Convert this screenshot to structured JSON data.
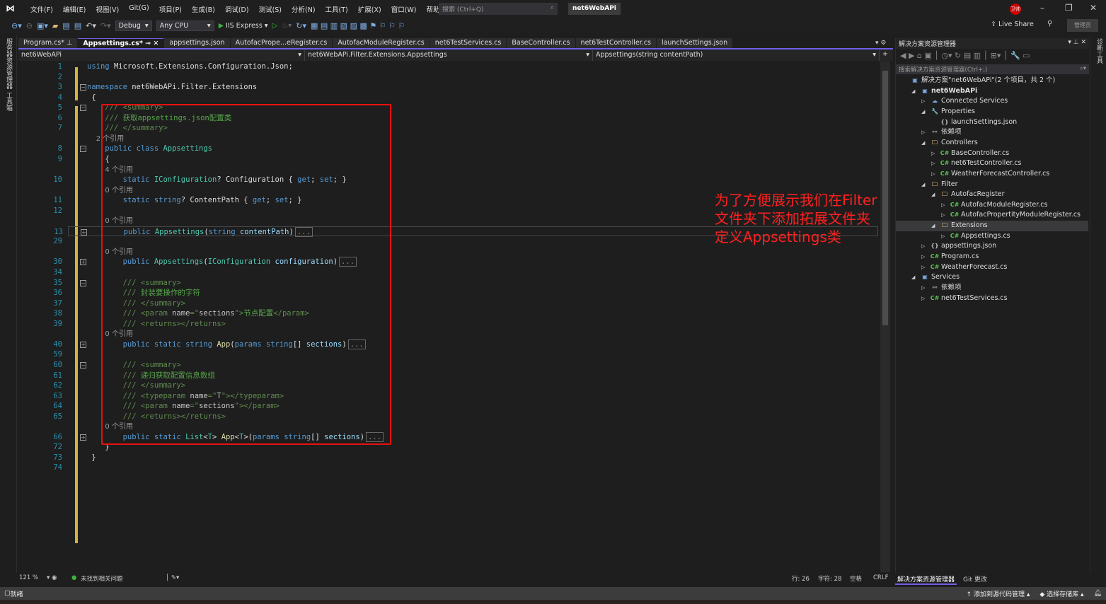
{
  "titlebar": {
    "menu": [
      "文件(F)",
      "编辑(E)",
      "视图(V)",
      "Git(G)",
      "项目(P)",
      "生成(B)",
      "调试(D)",
      "测试(S)",
      "分析(N)",
      "工具(T)",
      "扩展(X)",
      "窗口(W)",
      "帮助(H)"
    ],
    "search_placeholder": "搜索 (Ctrl+Q)",
    "project": "net6WebAPi",
    "avatar": "卫帅"
  },
  "toolbar": {
    "config": "Debug",
    "platform": "Any CPU",
    "run": "IIS Express",
    "live_share": "Live Share",
    "admin": "管理员"
  },
  "left_strip": [
    "服务器资源管理器",
    "工具箱"
  ],
  "tabs": [
    {
      "label": "Program.cs*",
      "active": false
    },
    {
      "label": "Appsettings.cs*",
      "active": true
    },
    {
      "label": "appsettings.json",
      "active": false
    },
    {
      "label": "AutofacPrope...eRegister.cs",
      "active": false
    },
    {
      "label": "AutofacModuleRegister.cs",
      "active": false
    },
    {
      "label": "net6TestServices.cs",
      "active": false
    },
    {
      "label": "BaseController.cs",
      "active": false
    },
    {
      "label": "net6TestController.cs",
      "active": false
    },
    {
      "label": "launchSettings.json",
      "active": false
    }
  ],
  "navbar": {
    "project": "net6WebAPi",
    "type": "net6WebAPi.Filter.Extensions.Appsettings",
    "member": "Appsettings(string contentPath)"
  },
  "code": [
    {
      "ln": "1",
      "t": [
        [
          "kw",
          "using "
        ],
        [
          "pl",
          "Microsoft.Extensions.Configuration.Json;"
        ]
      ]
    },
    {
      "ln": "2",
      "t": []
    },
    {
      "ln": "3",
      "f": "-",
      "t": [
        [
          "kw",
          "namespace "
        ],
        [
          "pl",
          "net6WebAPi.Filter.Extensions"
        ]
      ]
    },
    {
      "ln": "4",
      "t": [
        [
          "pl",
          " {"
        ]
      ]
    },
    {
      "ln": "5",
      "f": "-",
      "t": [
        [
          "cg",
          "    /// <summary>"
        ]
      ]
    },
    {
      "ln": "6",
      "t": [
        [
          "cg",
          "    /// "
        ],
        [
          "cm",
          "获取appsettings.json配置类"
        ]
      ]
    },
    {
      "ln": "7",
      "t": [
        [
          "cg",
          "    /// </summary>"
        ]
      ]
    },
    {
      "ln": "",
      "t": [
        [
          "lens",
          "    2 个引用"
        ]
      ]
    },
    {
      "ln": "8",
      "f": "-",
      "t": [
        [
          "kw",
          "    public class "
        ],
        [
          "ty",
          "Appsettings"
        ]
      ]
    },
    {
      "ln": "9",
      "t": [
        [
          "pl",
          "    {"
        ]
      ]
    },
    {
      "ln": "",
      "t": [
        [
          "lens",
          "        4 个引用"
        ]
      ]
    },
    {
      "ln": "10",
      "t": [
        [
          "kw",
          "        static "
        ],
        [
          "ty",
          "IConfiguration"
        ],
        [
          "pl",
          "? Configuration { "
        ],
        [
          "kw",
          "get"
        ],
        [
          "pl",
          "; "
        ],
        [
          "kw",
          "set"
        ],
        [
          "pl",
          "; }"
        ]
      ]
    },
    {
      "ln": "",
      "t": [
        [
          "lens",
          "        0 个引用"
        ]
      ]
    },
    {
      "ln": "11",
      "t": [
        [
          "kw",
          "        static string"
        ],
        [
          "pl",
          "? ContentPath { "
        ],
        [
          "kw",
          "get"
        ],
        [
          "pl",
          "; "
        ],
        [
          "kw",
          "set"
        ],
        [
          "pl",
          "; }"
        ]
      ]
    },
    {
      "ln": "12",
      "t": []
    },
    {
      "ln": "",
      "t": [
        [
          "lens",
          "        0 个引用"
        ]
      ]
    },
    {
      "ln": "13",
      "f": "+",
      "t": [
        [
          "kw",
          "        public "
        ],
        [
          "ty",
          "Appsettings"
        ],
        [
          "pl",
          "("
        ],
        [
          "kw",
          "string "
        ],
        [
          "par",
          "contentPath"
        ],
        [
          "pl",
          ")"
        ],
        [
          "coll",
          "..."
        ]
      ]
    },
    {
      "ln": "29",
      "t": []
    },
    {
      "ln": "",
      "t": [
        [
          "lens",
          "        0 个引用"
        ]
      ]
    },
    {
      "ln": "30",
      "f": "+",
      "t": [
        [
          "kw",
          "        public "
        ],
        [
          "ty",
          "Appsettings"
        ],
        [
          "pl",
          "("
        ],
        [
          "ty",
          "IConfiguration "
        ],
        [
          "par",
          "configuration"
        ],
        [
          "pl",
          ")"
        ],
        [
          "coll",
          "..."
        ]
      ]
    },
    {
      "ln": "34",
      "t": []
    },
    {
      "ln": "35",
      "f": "-",
      "t": [
        [
          "cg",
          "        /// <summary>"
        ]
      ]
    },
    {
      "ln": "36",
      "t": [
        [
          "cg",
          "        /// "
        ],
        [
          "cm",
          "封装要操作的字符"
        ]
      ]
    },
    {
      "ln": "37",
      "t": [
        [
          "cg",
          "        /// </summary>"
        ]
      ]
    },
    {
      "ln": "38",
      "t": [
        [
          "cg",
          "        /// <param "
        ],
        [
          "cx",
          "name"
        ],
        [
          "cg",
          "=\""
        ],
        [
          "cx",
          "sections"
        ],
        [
          "cg",
          "\">"
        ],
        [
          "cm",
          "节点配置"
        ],
        [
          "cg",
          "</param>"
        ]
      ]
    },
    {
      "ln": "39",
      "t": [
        [
          "cg",
          "        /// <returns></returns>"
        ]
      ]
    },
    {
      "ln": "",
      "t": [
        [
          "lens",
          "        0 个引用"
        ]
      ]
    },
    {
      "ln": "40",
      "f": "+",
      "t": [
        [
          "kw",
          "        public static string "
        ],
        [
          "me",
          "App"
        ],
        [
          "pl",
          "("
        ],
        [
          "kw",
          "params string"
        ],
        [
          "pl",
          "[] "
        ],
        [
          "par",
          "sections"
        ],
        [
          "pl",
          ")"
        ],
        [
          "coll",
          "..."
        ]
      ]
    },
    {
      "ln": "59",
      "t": []
    },
    {
      "ln": "60",
      "f": "-",
      "t": [
        [
          "cg",
          "        /// <summary>"
        ]
      ]
    },
    {
      "ln": "61",
      "t": [
        [
          "cg",
          "        /// "
        ],
        [
          "cm",
          "递归获取配置信息数组"
        ]
      ]
    },
    {
      "ln": "62",
      "t": [
        [
          "cg",
          "        /// </summary>"
        ]
      ]
    },
    {
      "ln": "63",
      "t": [
        [
          "cg",
          "        /// <typeparam "
        ],
        [
          "cx",
          "name"
        ],
        [
          "cg",
          "=\""
        ],
        [
          "cx",
          "T"
        ],
        [
          "cg",
          "\"></typeparam>"
        ]
      ]
    },
    {
      "ln": "64",
      "t": [
        [
          "cg",
          "        /// <param "
        ],
        [
          "cx",
          "name"
        ],
        [
          "cg",
          "=\""
        ],
        [
          "cx",
          "sections"
        ],
        [
          "cg",
          "\"></param>"
        ]
      ]
    },
    {
      "ln": "65",
      "t": [
        [
          "cg",
          "        /// <returns></returns>"
        ]
      ]
    },
    {
      "ln": "",
      "t": [
        [
          "lens",
          "        0 个引用"
        ]
      ]
    },
    {
      "ln": "66",
      "f": "+",
      "t": [
        [
          "kw",
          "        public static "
        ],
        [
          "ty",
          "List"
        ],
        [
          "pl",
          "<"
        ],
        [
          "ty",
          "T"
        ],
        [
          "pl",
          "> "
        ],
        [
          "me",
          "App"
        ],
        [
          "pl",
          "<"
        ],
        [
          "ty",
          "T"
        ],
        [
          "pl",
          ">("
        ],
        [
          "kw",
          "params string"
        ],
        [
          "pl",
          "[] "
        ],
        [
          "par",
          "sections"
        ],
        [
          "pl",
          ")"
        ],
        [
          "coll",
          "..."
        ]
      ]
    },
    {
      "ln": "72",
      "t": [
        [
          "pl",
          "    }"
        ]
      ]
    },
    {
      "ln": "73",
      "t": [
        [
          "pl",
          " }"
        ]
      ]
    },
    {
      "ln": "74",
      "t": []
    }
  ],
  "annotation": [
    "为了方便展示我们在Filter",
    "文件夹下添加拓展文件夹",
    "定义Appsettings类"
  ],
  "editor_status": {
    "zoom": "121 %",
    "issues": "未找到相关问题",
    "line": "行: 26",
    "char": "字符: 28",
    "spacing": "空格",
    "eol": "CRLF"
  },
  "solution_explorer": {
    "title": "解决方案资源管理器",
    "search": "搜索解决方案资源管理器(Ctrl+;)",
    "nodes": [
      {
        "label": "解决方案\"net6WebAPi\"(2 个项目，共 2 个)",
        "depth": 0,
        "icon": "solution-icon",
        "arrow": ""
      },
      {
        "label": "net6WebAPi",
        "depth": 1,
        "icon": "project-icon",
        "arrow": "open",
        "bold": true
      },
      {
        "label": "Connected Services",
        "depth": 2,
        "icon": "connected-services-icon",
        "arrow": "closed"
      },
      {
        "label": "Properties",
        "depth": 2,
        "icon": "properties-icon",
        "arrow": "open"
      },
      {
        "label": "launchSettings.json",
        "depth": 3,
        "icon": "json-icon",
        "arrow": ""
      },
      {
        "label": "依赖项",
        "depth": 2,
        "icon": "dependencies-icon",
        "arrow": "closed"
      },
      {
        "label": "Controllers",
        "depth": 2,
        "icon": "folder-icon",
        "arrow": "open"
      },
      {
        "label": "BaseController.cs",
        "depth": 3,
        "icon": "csharp-icon",
        "arrow": "closed"
      },
      {
        "label": "net6TestController.cs",
        "depth": 3,
        "icon": "csharp-icon",
        "arrow": "closed"
      },
      {
        "label": "WeatherForecastController.cs",
        "depth": 3,
        "icon": "csharp-icon",
        "arrow": "closed"
      },
      {
        "label": "Filter",
        "depth": 2,
        "icon": "folder-icon",
        "arrow": "open"
      },
      {
        "label": "AutofacRegister",
        "depth": 3,
        "icon": "folder-icon",
        "arrow": "open"
      },
      {
        "label": "AutofacModuleRegister.cs",
        "depth": 4,
        "icon": "csharp-icon",
        "arrow": "closed"
      },
      {
        "label": "AutofacPropertityModuleRegister.cs",
        "depth": 4,
        "icon": "csharp-icon",
        "arrow": "closed"
      },
      {
        "label": "Extensions",
        "depth": 3,
        "icon": "folder-icon",
        "arrow": "open",
        "selected": true
      },
      {
        "label": "Appsettings.cs",
        "depth": 4,
        "icon": "csharp-icon",
        "arrow": "closed"
      },
      {
        "label": "appsettings.json",
        "depth": 2,
        "icon": "json-icon",
        "arrow": "closed"
      },
      {
        "label": "Program.cs",
        "depth": 2,
        "icon": "csharp-icon",
        "arrow": "closed"
      },
      {
        "label": "WeatherForecast.cs",
        "depth": 2,
        "icon": "csharp-icon",
        "arrow": "closed"
      },
      {
        "label": "Services",
        "depth": 1,
        "icon": "project-icon",
        "arrow": "open"
      },
      {
        "label": "依赖项",
        "depth": 2,
        "icon": "dependencies-icon",
        "arrow": "closed"
      },
      {
        "label": "net6TestServices.cs",
        "depth": 2,
        "icon": "csharp-icon",
        "arrow": "closed"
      }
    ],
    "bottom_tabs": [
      "解决方案资源管理器",
      "Git 更改"
    ]
  },
  "right_strip": [
    "诊断工具"
  ],
  "statusbar": {
    "ready": "就绪",
    "add_source": "添加到源代码管理",
    "select_repo": "选择存储库"
  },
  "colors": {
    "accent": "#7160e8",
    "highlight": "#e81010",
    "keyword": "#569cd6",
    "type": "#4ec9b0",
    "comment": "#57a64a"
  }
}
